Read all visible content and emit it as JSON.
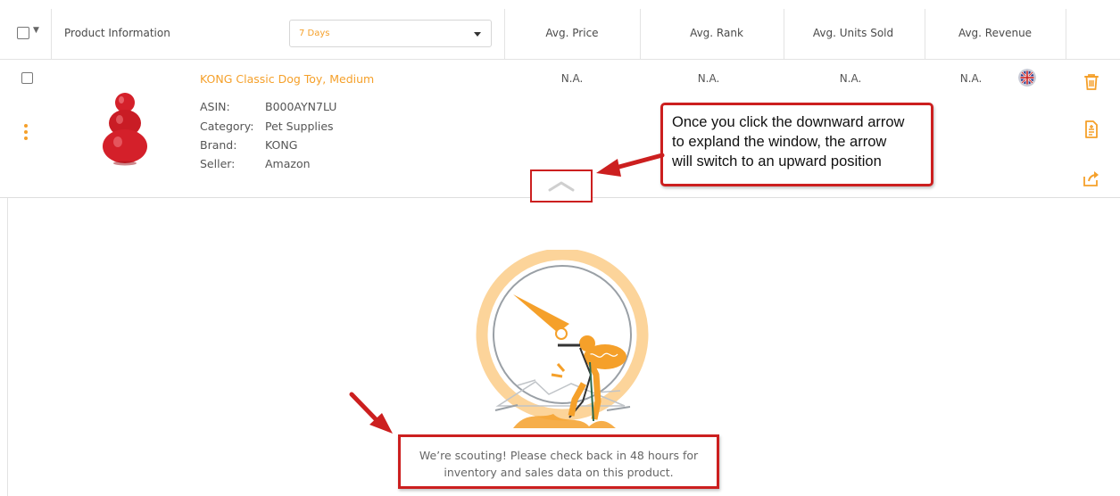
{
  "header": {
    "product_info": "Product Information",
    "period": "7 Days",
    "avg_price": "Avg. Price",
    "avg_rank": "Avg. Rank",
    "avg_units_sold": "Avg. Units Sold",
    "avg_revenue": "Avg. Revenue"
  },
  "product": {
    "title": "KONG Classic Dog Toy, Medium",
    "asin_label": "ASIN:",
    "asin": "B000AYN7LU",
    "category_label": "Category:",
    "category": "Pet Supplies",
    "brand_label": "Brand:",
    "brand": "KONG",
    "seller_label": "Seller:",
    "seller": "Amazon",
    "avg_price": "N.A.",
    "avg_rank": "N.A.",
    "avg_units_sold": "N.A.",
    "avg_revenue": "N.A.",
    "marketplace_flag": "uk-flag-icon"
  },
  "callout": {
    "line1": "Once you click the downward arrow",
    "line2": "to expland the window, the arrow",
    "line3": "will switch to an upward position"
  },
  "empty_state": {
    "line1": "We’re scouting! Please check back in 48 hours for",
    "line2": "inventory and sales data on this product."
  },
  "icons": {
    "delete": "trash-icon",
    "notes": "document-icon",
    "export": "share-icon",
    "collapse": "chevron-up-icon",
    "more": "kebab-menu-icon"
  },
  "colors": {
    "accent": "#f5a02a",
    "annotation": "#cc1f1f",
    "product_red": "#d4202a"
  }
}
